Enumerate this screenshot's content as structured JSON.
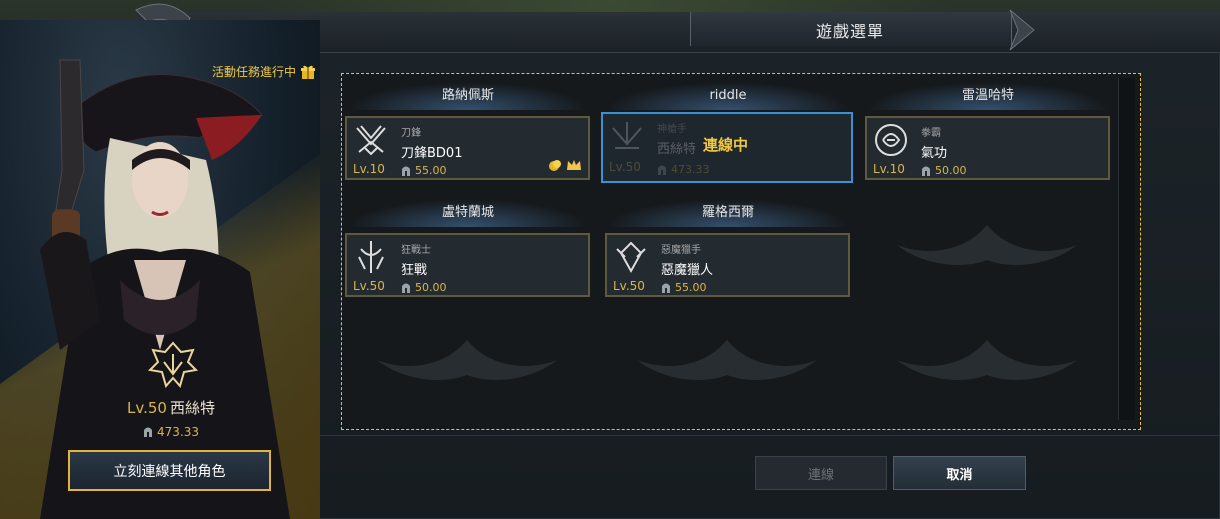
{
  "window": {
    "title": "遊戲選單"
  },
  "quest_banner": {
    "text": "活動任務進行中",
    "icon": "gift-icon"
  },
  "current_character": {
    "level": "Lv.50",
    "name": "西絲特",
    "power": "473.33",
    "switch_button": "立刻連線其他角色"
  },
  "servers": [
    {
      "name": "路納佩斯",
      "characters": [
        {
          "class": "刀鋒",
          "name": "刀鋒BD01",
          "level": "Lv.10",
          "power": "55.00",
          "emblem": "blade-class-icon",
          "badges": [
            "coin-icon",
            "crown-icon"
          ]
        }
      ]
    },
    {
      "name": "riddle",
      "characters": [
        {
          "class": "神槍手",
          "name": "西絲特",
          "level": "Lv.50",
          "power": "473.33",
          "emblem": "gunslinger-class-icon",
          "status": "連線中"
        }
      ]
    },
    {
      "name": "雷溫哈特",
      "characters": [
        {
          "class": "拳霸",
          "name": "氣功",
          "level": "Lv.10",
          "power": "50.00",
          "emblem": "martial-artist-class-icon"
        }
      ]
    },
    {
      "name": "盧特蘭城",
      "characters": [
        {
          "class": "狂戰士",
          "name": "狂戰",
          "level": "Lv.50",
          "power": "50.00",
          "emblem": "berserker-class-icon"
        }
      ]
    },
    {
      "name": "羅格西爾",
      "characters": [
        {
          "class": "惡魔獵手",
          "name": "惡魔獵人",
          "level": "Lv.50",
          "power": "55.00",
          "emblem": "demon-hunter-class-icon"
        }
      ]
    }
  ],
  "buttons": {
    "connect": "連線",
    "cancel": "取消"
  },
  "colors": {
    "accent_gold": "#e1b43a",
    "selection_blue": "#3d8fd6",
    "status_text": "#f1c93c"
  }
}
